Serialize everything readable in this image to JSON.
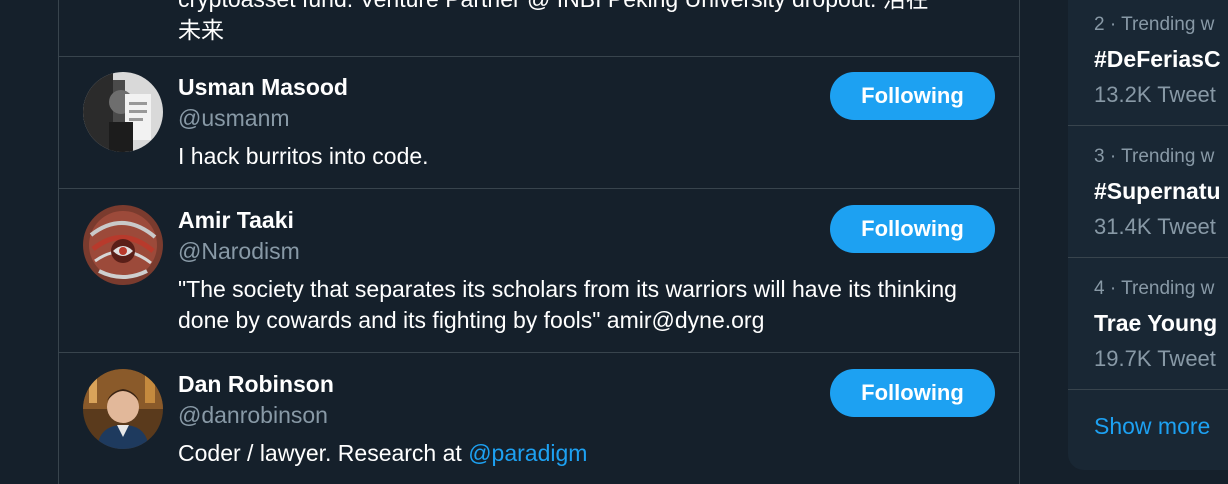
{
  "following_list": {
    "partial_top_bio": "cryptoasset fund. Venture Partner @ INBI Peking University dropout. 活在\n未来",
    "users": [
      {
        "name": "Usman Masood",
        "handle": "@usmanm",
        "bio": "I hack burritos into code.",
        "button_label": "Following"
      },
      {
        "name": "Amir Taaki",
        "handle": "@Narodism",
        "bio": "\"The society that separates its scholars from its warriors will have its thinking done by cowards and its fighting by fools\" amir@dyne.org",
        "button_label": "Following"
      },
      {
        "name": "Dan Robinson",
        "handle": "@danrobinson",
        "bio_prefix": "Coder / lawyer. Research at ",
        "bio_mention": "@paradigm",
        "button_label": "Following"
      }
    ]
  },
  "trends": {
    "items": [
      {
        "meta": "2 · Trending w",
        "name": "#DeFeriasC",
        "count": "13.2K Tweet"
      },
      {
        "meta": "3 · Trending w",
        "name": "#Supernatu",
        "count": "31.4K Tweet"
      },
      {
        "meta": "4 · Trending w",
        "name": "Trae Young",
        "count": "19.7K Tweet"
      }
    ],
    "show_more_label": "Show more"
  },
  "colors": {
    "background": "#15202b",
    "card": "#192734",
    "accent": "#1da1f2",
    "muted_text": "#8899a6",
    "border": "#38444d"
  }
}
